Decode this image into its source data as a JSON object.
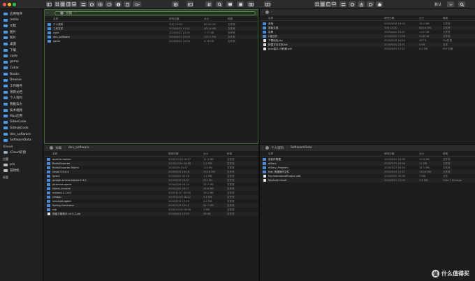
{
  "toolbar": {
    "user_label": "默认",
    "traffic_colors": [
      "#ff5f57",
      "#febc2e",
      "#28c840"
    ]
  },
  "sidebar": {
    "favorites": [
      "应用程序",
      "remix",
      "文稿",
      "图片",
      "照片",
      "桌面",
      "下载",
      "code",
      "game",
      "Cellar",
      "Books",
      "Downie",
      "工作服务",
      "项目文档",
      "个人资料",
      "我推云大",
      "技术视频",
      "Mac应用",
      "GiteeCode",
      "GithubCode",
      "dev_software",
      "SoftwareData"
    ],
    "section_icloud": "iCloud",
    "icloud": [
      "iCloud云盘"
    ],
    "section_locations": "位置",
    "locations": [
      "pro",
      "游戏机"
    ],
    "section_tags": "标签"
  },
  "columns": {
    "name": "名称",
    "date": "修改日期",
    "size": "大小",
    "kind": "种类"
  },
  "pane_tl": {
    "path": [
      "文稿"
    ],
    "rows": [
      {
        "name": "个人资料",
        "date": "今天 23:59",
        "size": "89.52 GB",
        "kind": "文件夹",
        "folder": true
      },
      {
        "name": "工作文件",
        "date": "2020/6/22 17:51",
        "size": "401.6 MB",
        "kind": "文件夹",
        "folder": true
      },
      {
        "name": "code",
        "date": "2020/6/22 21:05",
        "size": "7.77 GB",
        "kind": "文件夹",
        "folder": true
      },
      {
        "name": "dev_software",
        "date": "2020/6/21 15:53",
        "size": "232.5 MB",
        "kind": "文件夹",
        "folder": true
      },
      {
        "name": "game",
        "date": "2020/6/22 14:04",
        "size": "4.16 GB",
        "kind": "文件夹",
        "folder": true
      }
    ]
  },
  "pane_tr": {
    "path": [],
    "rows": [
      {
        "name": "其他",
        "date": "2020/6/18 14:03",
        "size": "19.1 MB",
        "kind": "文件夹",
        "folder": true
      },
      {
        "name": "原始文档",
        "date": "今天 15:30",
        "size": "834.6 MB",
        "kind": "文件夹",
        "folder": true
      },
      {
        "name": "发票",
        "date": "2020/6/22 10:47",
        "size": "1.57 GB",
        "kind": "文件夹",
        "folder": true
      },
      {
        "name": "U盘文件",
        "date": "2020/6/22 17:28",
        "size": "9.46 GB",
        "kind": "文件夹",
        "folder": true
      },
      {
        "name": "下载地址.zip",
        "date": "2020/6/18 16:54",
        "size": "497 B",
        "kind": "Zip归档",
        "folder": false
      },
      {
        "name": "新建文本文档.txt",
        "date": "2020/6/20 22:51",
        "size": "4 KB",
        "kind": "文本",
        "folder": false
      },
      {
        "name": "Java高手-代码篇.pdf",
        "date": "2020/6/21 17:17",
        "size": "4.2 MB",
        "kind": "PDF文稿",
        "folder": false
      }
    ]
  },
  "pane_bl": {
    "path": [
      "文稿",
      "dev_software"
    ],
    "rows": [
      {
        "name": "apache-maven",
        "date": "2019/12/10 14:57",
        "size": "11.3 MB",
        "kind": "文件夹",
        "folder": true
      },
      {
        "name": "BaiduExporter",
        "date": "2019/12/16 16:56",
        "size": "1.2 MB",
        "kind": "文件夹",
        "folder": true
      },
      {
        "name": "BaiduExporter-Motrix",
        "date": "2020/3/5 14:17",
        "size": "114 KB",
        "kind": "文件夹",
        "folder": true
      },
      {
        "name": "cmak-3.0.0.4",
        "date": "2020/6/22 16:18",
        "size": "102.8 MB",
        "kind": "文件夹",
        "folder": true
      },
      {
        "name": "fgrect",
        "date": "2020/6/20 22:16",
        "size": "1.1 MB",
        "kind": "文件夹",
        "folder": true
      },
      {
        "name": "google-access-helper-2.3.0",
        "date": "2019/8/19 23:37",
        "size": "251 KB",
        "kind": "文件夹",
        "folder": true
      },
      {
        "name": "jetbrains-agent",
        "date": "2020/5/26 16:14",
        "size": "15.7 MB",
        "kind": "文件夹",
        "folder": true
      },
      {
        "name": "kibert_chrome",
        "date": "2020/3/20 18:17",
        "size": "13.6 MB",
        "kind": "文件夹",
        "folder": true
      },
      {
        "name": "mahout-0.14.0",
        "date": "2019/11/27 09:20",
        "size": "18.2 MB",
        "kind": "文件夹",
        "folder": true
      },
      {
        "name": "natapp",
        "date": "2019/12/19 18:12",
        "size": "9.4 MB",
        "kind": "文件夹",
        "folder": true
      },
      {
        "name": "smartgit-agent",
        "date": "2020/4/15 17:15",
        "size": "2.2 MB",
        "kind": "文件夹",
        "folder": true
      },
      {
        "name": "Spring-Generator",
        "date": "2020/3/29 16:11",
        "size": "54.7 MB",
        "kind": "文件夹",
        "folder": true
      },
      {
        "name": "ssb",
        "date": "2019/12/16 16:56",
        "size": "1 MB",
        "kind": "文件夹",
        "folder": true
      },
      {
        "name": "网盘万能助手 v2.5.2.zip",
        "date": "2020/6/21 15:53",
        "size": "56 KB",
        "kind": "文件夹",
        "folder": false
      }
    ]
  },
  "pane_br": {
    "path": [
      "个人资料",
      "SoftwareData"
    ],
    "rows": [
      {
        "name": "各软件数据",
        "date": "2019/6/21 18:56",
        "size": "10.6 MB",
        "kind": "文件夹",
        "folder": true
      },
      {
        "name": "eDiary",
        "date": "2020/5/22 19:58",
        "size": "11 MB",
        "kind": "文件夹",
        "folder": true
      },
      {
        "name": "eDiary_Program",
        "date": "2020/3/17 00:34",
        "size": "16.1 MB",
        "kind": "文件夹",
        "folder": true
      },
      {
        "name": "Mac 快捷操作文件",
        "date": "2020/6/22 11:17",
        "size": "118.6 MB",
        "kind": "文件夹",
        "folder": true
      },
      {
        "name": "MyUnderstandProject.udb",
        "date": "2020/6/22 09:38",
        "size": "7 MB",
        "kind": "文件",
        "folder": false
      },
      {
        "name": "MyVault.hnsult",
        "date": "2020/6/21 15:59",
        "size": "2.8 MB",
        "kind": "Hide 2 Storage",
        "folder": false
      }
    ]
  },
  "watermark": {
    "badge": "值",
    "text": "什么值得买"
  }
}
